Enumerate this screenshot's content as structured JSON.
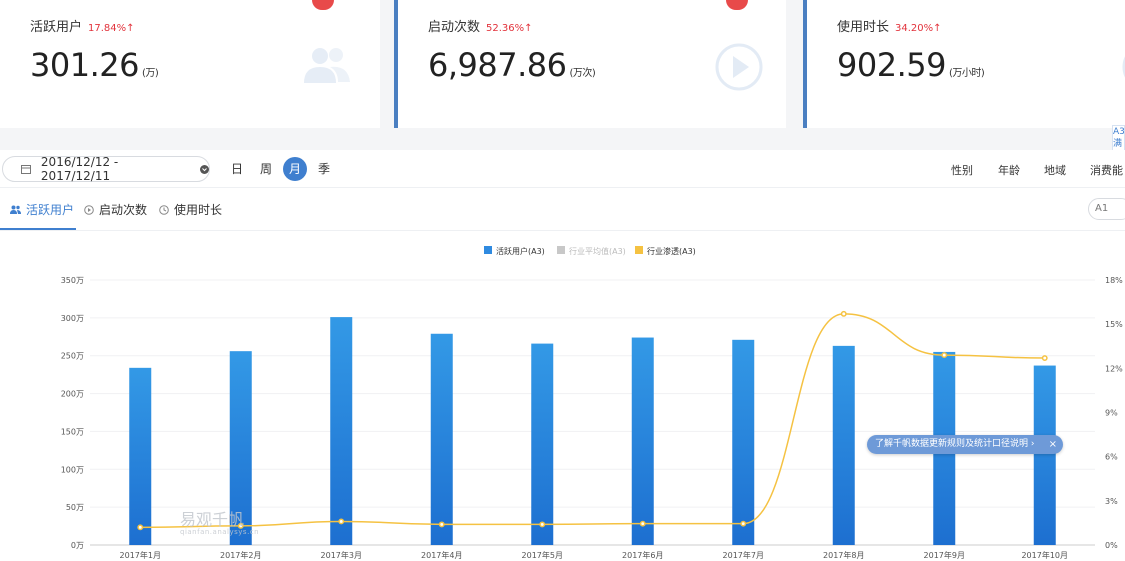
{
  "kpis": [
    {
      "label": "活跃用户",
      "change": "17.84%↑",
      "value": "301.26",
      "unit": "(万)",
      "icon": "users-icon"
    },
    {
      "label": "启动次数",
      "change": "52.36%↑",
      "value": "6,987.86",
      "unit": "(万次)",
      "icon": "play-icon"
    },
    {
      "label": "使用时长",
      "change": "34.20%↑",
      "value": "902.59",
      "unit": "(万小时)",
      "icon": "clock-icon"
    }
  ],
  "toolbar": {
    "date_range": "2016/12/12 - 2017/12/11",
    "granularity": [
      "日",
      "周",
      "月",
      "季"
    ],
    "granularity_selected": "月",
    "filters": [
      "性别",
      "年龄",
      "地域",
      "消费能"
    ]
  },
  "tabs": [
    {
      "label": "活跃用户",
      "active": true
    },
    {
      "label": "启动次数",
      "active": false
    },
    {
      "label": "使用时长",
      "active": false
    }
  ],
  "pill": "A1",
  "side_note": "A3 满",
  "tooltip": {
    "text": "了解千帆数据更新规则及统计口径说明 ›",
    "close": "×"
  },
  "watermark": {
    "main": "易观千帆",
    "sub": "qianfan.analysys.cn"
  },
  "colors": {
    "accent": "#3f7fcf",
    "bar": "#2f8ae0",
    "line": "#f5c242",
    "up": "#e2333c"
  },
  "chart_data": {
    "type": "bar",
    "categories": [
      "2017年1月",
      "2017年2月",
      "2017年3月",
      "2017年4月",
      "2017年5月",
      "2017年6月",
      "2017年7月",
      "2017年8月",
      "2017年9月",
      "2017年10月"
    ],
    "series": [
      {
        "name": "活跃用户(A3)",
        "type": "bar",
        "axis": "left",
        "values": [
          234,
          256,
          301,
          279,
          266,
          274,
          271,
          263,
          255,
          237
        ]
      },
      {
        "name": "行业平均值(A3)",
        "type": "line",
        "axis": "left",
        "values": [],
        "disabled": true
      },
      {
        "name": "行业渗透(A3)",
        "type": "line",
        "axis": "right",
        "values": [
          1.2,
          1.3,
          1.6,
          1.4,
          1.4,
          1.45,
          1.45,
          15.7,
          12.9,
          12.7
        ]
      }
    ],
    "y_left": {
      "ticks": [
        "350万",
        "300万",
        "250万",
        "200万",
        "150万",
        "100万",
        "50万",
        "0万"
      ],
      "min": 0,
      "max": 350
    },
    "y_right": {
      "ticks": [
        "18%",
        "15%",
        "12%",
        "9%",
        "6%",
        "3%",
        "0%"
      ],
      "min": 0,
      "max": 18
    },
    "legend_position": "top-center",
    "grid": true
  }
}
